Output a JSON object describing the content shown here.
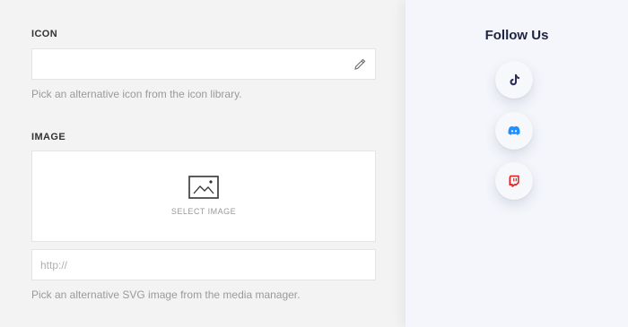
{
  "icon_section": {
    "label": "ICON",
    "value": "",
    "help": "Pick an alternative icon from the icon library."
  },
  "image_section": {
    "label": "IMAGE",
    "select_label": "SELECT IMAGE",
    "url_placeholder": "http://",
    "url_value": "",
    "help": "Pick an alternative SVG image from the media manager."
  },
  "preview": {
    "title": "Follow Us",
    "socials": [
      {
        "name": "tiktok",
        "icon": "tiktok-icon",
        "color": "#2f2d5c"
      },
      {
        "name": "discord",
        "icon": "discord-icon",
        "color": "#1e90ff"
      },
      {
        "name": "twitch",
        "icon": "twitch-icon",
        "color": "#e0201c"
      }
    ]
  }
}
